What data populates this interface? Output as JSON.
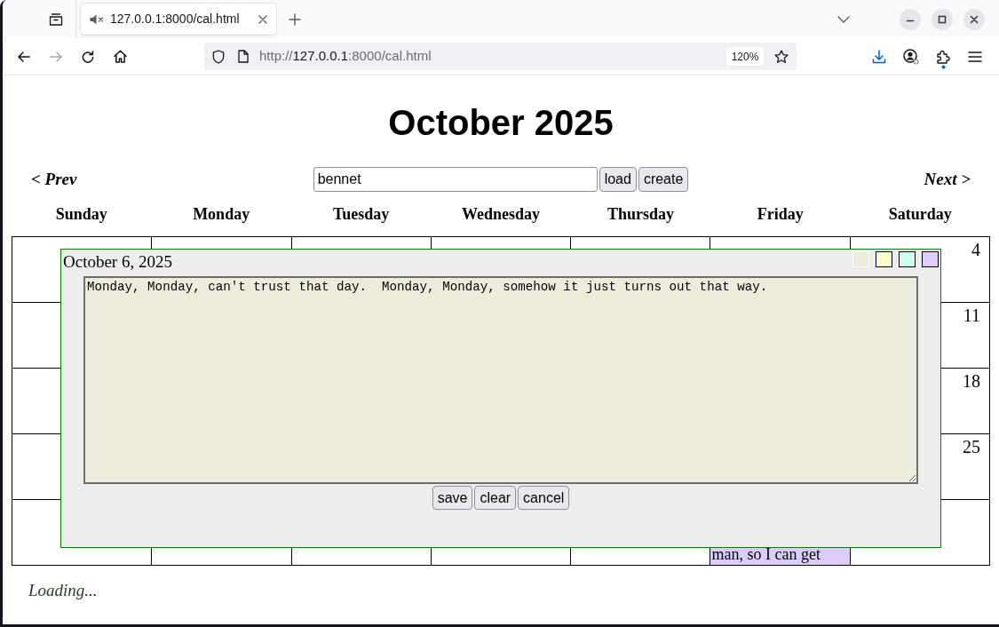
{
  "browser": {
    "tabs": [
      {
        "title": "127.0.0.1:8000/cal.html",
        "selected": true
      }
    ],
    "nav_buttons": [
      {
        "kind": "back",
        "disabled": false
      },
      {
        "kind": "forward",
        "disabled": true
      },
      {
        "kind": "reload",
        "disabled": false
      },
      {
        "kind": "home",
        "disabled": false
      }
    ],
    "address": {
      "scheme": "http://",
      "host": "127.0.0.1",
      "path": ":8000/cal.html"
    },
    "zoom": "120%"
  },
  "page": {
    "title": "October 2025",
    "prev_link": "< Prev",
    "next_link": "Next >",
    "calendar_field": {
      "value": "bennet"
    },
    "buttons": [
      "load",
      "create"
    ],
    "weekdays": [
      "Sunday",
      "Monday",
      "Tuesday",
      "Wednesday",
      "Thursday",
      "Friday",
      "Saturday"
    ],
    "weeks": [
      {
        "saturday": {
          "day": "4"
        }
      },
      {
        "saturday": {
          "day": "11"
        }
      },
      {
        "saturday": {
          "day": "18"
        }
      },
      {
        "saturday": {
          "day": "25"
        }
      },
      {
        "friday": {
          "note": "man, so I can get",
          "color": "#ddccff"
        }
      }
    ],
    "status": "Loading..."
  },
  "dialog": {
    "title": "October 6, 2025",
    "swatches": [
      {
        "color": "#ecebdc",
        "selected": true
      },
      {
        "color": "#ffffcc",
        "selected": false
      },
      {
        "color": "#ccffee",
        "selected": false
      },
      {
        "color": "#ddccff",
        "selected": false
      }
    ],
    "text": "Monday, Monday, can't trust that day.  Monday, Monday, somehow it just turns out that way.",
    "buttons": [
      "save",
      "clear",
      "cancel"
    ]
  }
}
